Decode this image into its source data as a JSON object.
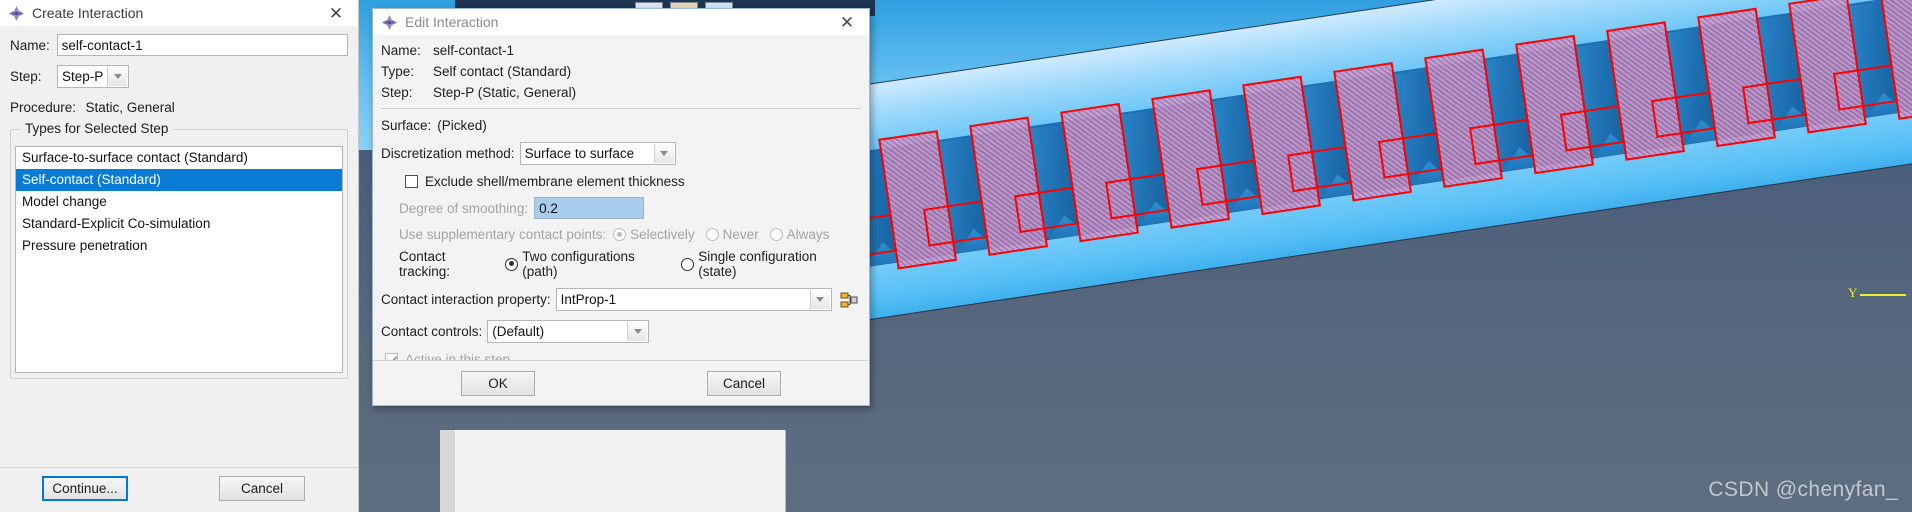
{
  "viewport": {
    "axis_label": "Y",
    "watermark": "CSDN @chenyfan_"
  },
  "create_dialog": {
    "title": "Create Interaction",
    "close_glyph": "✕",
    "name_label": "Name:",
    "name_value": "self-contact-1",
    "step_label": "Step:",
    "step_value": "Step-P",
    "procedure_label": "Procedure:",
    "procedure_value": "Static, General",
    "group_caption": "Types for Selected Step",
    "types": [
      "Surface-to-surface contact (Standard)",
      "Self-contact (Standard)",
      "Model change",
      "Standard-Explicit Co-simulation",
      "Pressure penetration"
    ],
    "selected_type_index": 1,
    "continue_label": "Continue...",
    "cancel_label": "Cancel"
  },
  "edit_dialog": {
    "title": "Edit Interaction",
    "close_glyph": "✕",
    "name_label": "Name:",
    "name_value": "self-contact-1",
    "type_label": "Type:",
    "type_value": "Self contact (Standard)",
    "step_label": "Step:",
    "step_value": "Step-P (Static, General)",
    "surface_label": "Surface:",
    "surface_value": "(Picked)",
    "discretization_label": "Discretization method:",
    "discretization_value": "Surface to surface",
    "exclude_label": "Exclude shell/membrane element thickness",
    "exclude_checked": false,
    "smoothing_label": "Degree of smoothing:",
    "smoothing_value": "0.2",
    "smoothing_enabled": false,
    "supplementary_label": "Use supplementary contact points:",
    "supplementary_options": [
      "Selectively",
      "Never",
      "Always"
    ],
    "supplementary_selected": "Selectively",
    "supplementary_enabled": false,
    "tracking_label": "Contact tracking:",
    "tracking_options": [
      "Two configurations (path)",
      "Single configuration (state)"
    ],
    "tracking_selected": "Two configurations (path)",
    "property_label": "Contact interaction property:",
    "property_value": "IntProp-1",
    "controls_label": "Contact controls:",
    "controls_value": "(Default)",
    "active_label": "Active in this step",
    "active_checked": true,
    "active_enabled": false,
    "ok_label": "OK",
    "cancel_label": "Cancel"
  },
  "colors": {
    "selection_blue": "#0a7bd4",
    "focus_blue": "#0078d7",
    "field_selected": "#a8cdec",
    "picked_surface_outline": "#ff0000",
    "axis_yellow": "#e8ef2a"
  }
}
